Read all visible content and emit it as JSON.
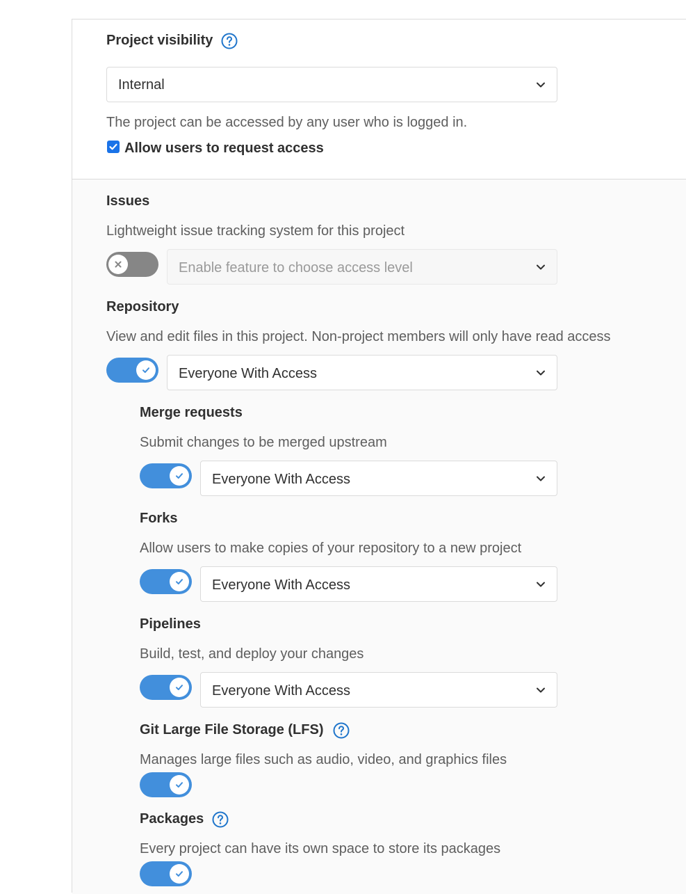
{
  "visibility": {
    "label": "Project visibility",
    "help_icon": "question-circle-icon",
    "selected": "Internal",
    "description": "The project can be accessed by any user who is logged in.",
    "request_access_label": "Allow users to request access",
    "request_access_checked": true
  },
  "features": {
    "issues": {
      "title": "Issues",
      "description": "Lightweight issue tracking system for this project",
      "enabled": false,
      "access_level": "Enable feature to choose access level"
    },
    "repository": {
      "title": "Repository",
      "description": "View and edit files in this project. Non-project members will only have read access",
      "enabled": true,
      "access_level": "Everyone With Access"
    },
    "merge_requests": {
      "title": "Merge requests",
      "description": "Submit changes to be merged upstream",
      "enabled": true,
      "access_level": "Everyone With Access"
    },
    "forks": {
      "title": "Forks",
      "description": "Allow users to make copies of your repository to a new project",
      "enabled": true,
      "access_level": "Everyone With Access"
    },
    "pipelines": {
      "title": "Pipelines",
      "description": "Build, test, and deploy your changes",
      "enabled": true,
      "access_level": "Everyone With Access"
    },
    "lfs": {
      "title": "Git Large File Storage (LFS)",
      "description": "Manages large files such as audio, video, and graphics files",
      "enabled": true
    },
    "packages": {
      "title": "Packages",
      "description": "Every project can have its own space to store its packages",
      "enabled": true
    }
  },
  "colors": {
    "toggle_on": "#428fdc",
    "toggle_off": "#868686",
    "help_icon": "#1f75cb",
    "checkbox": "#1a73e8"
  }
}
